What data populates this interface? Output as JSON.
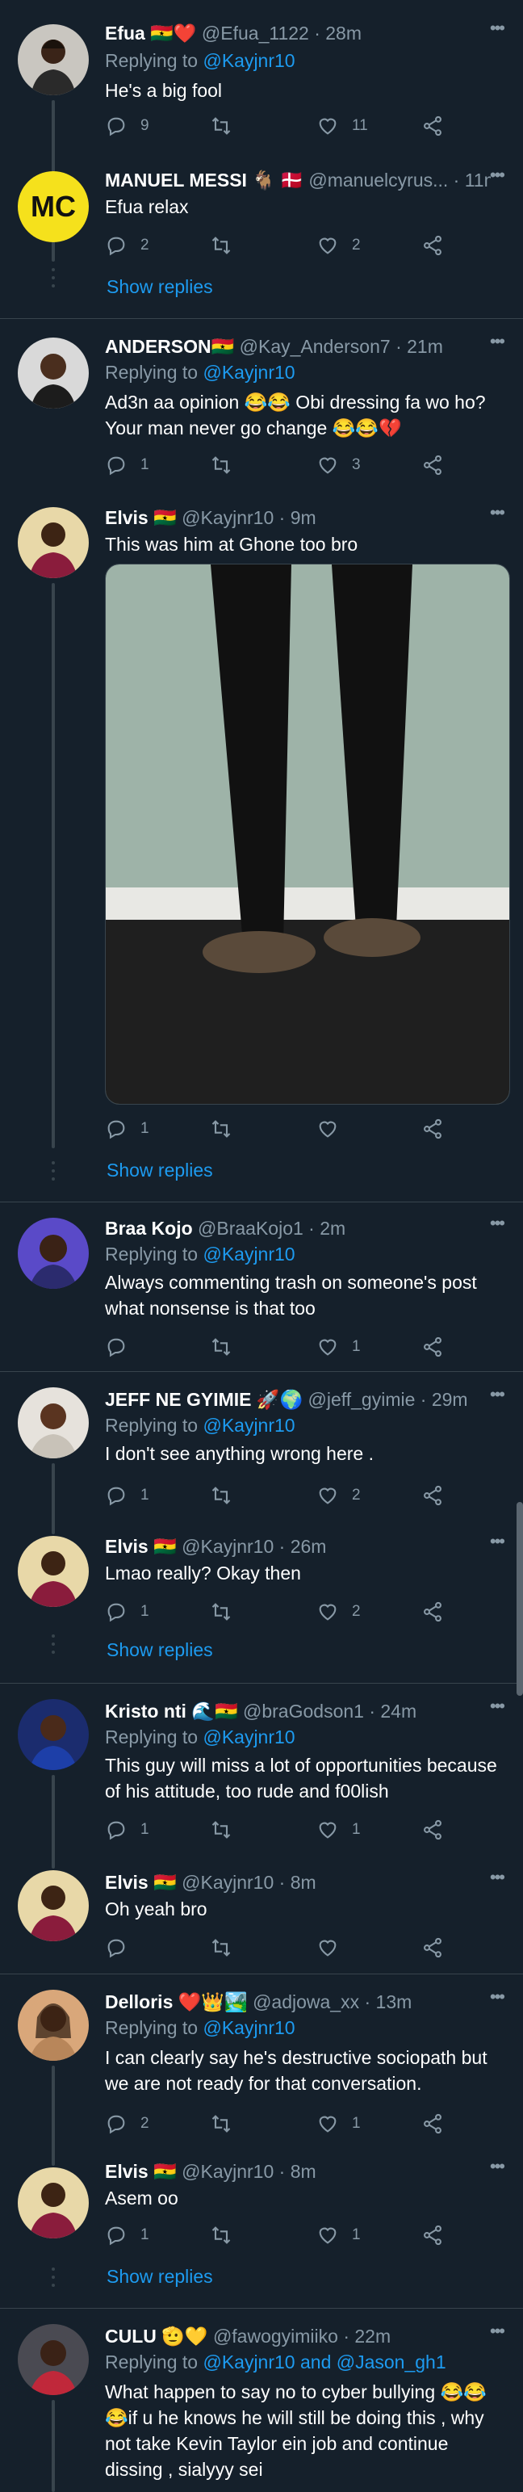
{
  "tweets": [
    {
      "name": "Efua 🇬🇭❤️",
      "handle": "@Efua_1122 · 28m",
      "replying": "Replying to ",
      "mention": "@Kayjnr10",
      "text": "He's a big fool",
      "replies": "9",
      "retweets": "",
      "likes": "11"
    },
    {
      "name": "MANUEL MESSI 🐐 🇩🇰",
      "handle": "@manuelcyrus... · 11m",
      "text": "Efua relax",
      "replies": "2",
      "retweets": "",
      "likes": "2",
      "show_replies": "Show replies"
    },
    {
      "name": "ANDERSON🇬🇭",
      "handle": "@Kay_Anderson7 · 21m",
      "replying": "Replying to ",
      "mention": "@Kayjnr10",
      "text": "Ad3n aa opinion 😂😂 Obi dressing fa wo ho? Your man never go change 😂😂💔",
      "replies": "1",
      "retweets": "",
      "likes": "3"
    },
    {
      "name": "Elvis 🇬🇭",
      "handle": "@Kayjnr10 · 9m",
      "text": "This was him at Ghone too bro",
      "replies": "1",
      "retweets": "",
      "likes": "",
      "show_replies": "Show replies"
    },
    {
      "name": "Braa Kojo",
      "handle": "@BraaKojo1 · 2m",
      "replying": "Replying to ",
      "mention": "@Kayjnr10",
      "text": "Always commenting trash on someone's post what nonsense is that too",
      "replies": "",
      "retweets": "",
      "likes": "1"
    },
    {
      "name": "JEFF NE GYIMIE 🚀🌍",
      "handle": "@jeff_gyimie · 29m",
      "replying": "Replying to ",
      "mention": "@Kayjnr10",
      "text": "I don't see anything wrong here .",
      "replies": "1",
      "retweets": "",
      "likes": "2"
    },
    {
      "name": "Elvis 🇬🇭",
      "handle": "@Kayjnr10 · 26m",
      "text": "Lmao really? Okay then",
      "replies": "1",
      "retweets": "",
      "likes": "2",
      "show_replies": "Show replies"
    },
    {
      "name": "Kristo nti 🌊🇬🇭",
      "handle": "@braGodson1 · 24m",
      "replying": "Replying to ",
      "mention": "@Kayjnr10",
      "text": "This guy will miss a lot of opportunities because of his attitude, too rude and f00lish",
      "replies": "1",
      "retweets": "",
      "likes": "1"
    },
    {
      "name": "Elvis 🇬🇭",
      "handle": "@Kayjnr10 · 8m",
      "text": "Oh yeah bro",
      "replies": "",
      "retweets": "",
      "likes": ""
    },
    {
      "name": "Delloris ❤️👑🏞️",
      "handle": "@adjowa_xx · 13m",
      "replying": "Replying to ",
      "mention": "@Kayjnr10",
      "text": "I can clearly say he's destructive sociopath but we are not ready for that conversation.",
      "replies": "2",
      "retweets": "",
      "likes": "1"
    },
    {
      "name": "Elvis 🇬🇭",
      "handle": "@Kayjnr10 · 8m",
      "text": "Asem oo",
      "replies": "1",
      "retweets": "",
      "likes": "1",
      "show_replies": "Show replies"
    },
    {
      "name": "CULU 🫡💛",
      "handle": "@fawogyimiiko · 22m",
      "replying": "Replying to ",
      "mention": "@Kayjnr10 and @Jason_gh1",
      "text": "What happen to say no to cyber bullying 😂😂😂if u he knows he will still be doing this , why not take Kevin Taylor ein job and continue dissing , sialyyy sei"
    }
  ],
  "icons": {
    "reply": "reply-icon",
    "retweet": "retweet-icon",
    "like": "heart-icon",
    "share": "share-icon",
    "more": "more-icon"
  },
  "colors": {
    "background": "#15202b",
    "accent": "#1d9bf0",
    "muted": "#8899a6",
    "divider": "#38444d"
  }
}
